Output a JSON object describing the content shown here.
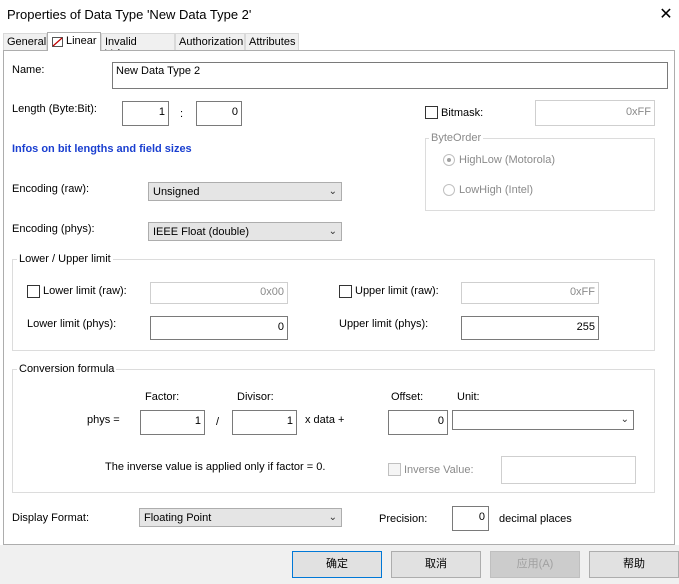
{
  "window": {
    "title": "Properties of Data Type 'New Data Type 2'",
    "close_glyph": "✕"
  },
  "tabs": [
    {
      "label": "General"
    },
    {
      "label": "Linear"
    },
    {
      "label": "Invalid Values"
    },
    {
      "label": "Authorization"
    },
    {
      "label": "Attributes"
    }
  ],
  "form": {
    "name_label": "Name:",
    "name_value": "New Data Type 2",
    "length_label": "Length (Byte:Bit):",
    "length_byte": "1",
    "length_sep": ":",
    "length_bit": "0",
    "bitmask_label": "Bitmask:",
    "bitmask_value": "0xFF",
    "info_link": "Infos on bit lengths and field sizes",
    "byteorder_title": "ByteOrder",
    "byteorder_options": [
      "HighLow (Motorola)",
      "LowHigh (Intel)"
    ],
    "encoding_raw_label": "Encoding (raw):",
    "encoding_raw_value": "Unsigned",
    "encoding_phys_label": "Encoding (phys):",
    "encoding_phys_value": "IEEE Float (double)"
  },
  "limits": {
    "title": "Lower / Upper limit",
    "lower_raw_label": "Lower limit (raw):",
    "lower_raw_value": "0x00",
    "upper_raw_label": "Upper limit (raw):",
    "upper_raw_value": "0xFF",
    "lower_phys_label": "Lower limit (phys):",
    "lower_phys_value": "0",
    "upper_phys_label": "Upper limit (phys):",
    "upper_phys_value": "255"
  },
  "conversion": {
    "title": "Conversion formula",
    "factor_label": "Factor:",
    "divisor_label": "Divisor:",
    "offset_label": "Offset:",
    "unit_label": "Unit:",
    "phys_eq": "phys  =",
    "slash": "/",
    "x_data_plus": "x  data  +",
    "factor_value": "1",
    "divisor_value": "1",
    "offset_value": "0",
    "unit_value": "",
    "inverse_note": "The inverse value is applied only if factor = 0.",
    "inverse_label": "Inverse Value:",
    "inverse_value": ""
  },
  "display": {
    "format_label": "Display Format:",
    "format_value": "Floating Point",
    "precision_label": "Precision:",
    "precision_value": "0",
    "decimal_label": "decimal places"
  },
  "buttons": {
    "ok": "确定",
    "cancel": "取消",
    "apply": "应用(A)",
    "help": "帮助"
  },
  "icons": {
    "chevron": "⌄"
  }
}
